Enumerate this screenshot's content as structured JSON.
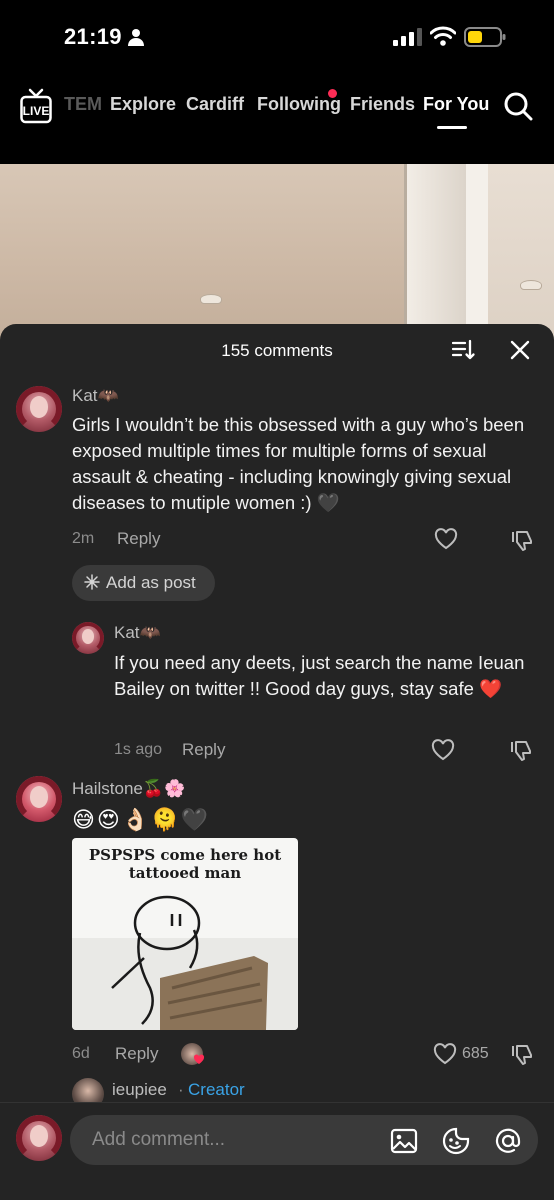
{
  "status_bar": {
    "time": "21:19"
  },
  "nav": {
    "items": [
      {
        "label": "TEM",
        "state": "faded"
      },
      {
        "label": "Explore",
        "state": "normal"
      },
      {
        "label": "Cardiff",
        "state": "normal"
      },
      {
        "label": "Following",
        "state": "normal",
        "badge": true
      },
      {
        "label": "Friends",
        "state": "normal"
      },
      {
        "label": "For You",
        "state": "active"
      }
    ],
    "live_label": "LIVE"
  },
  "sheet": {
    "title": "155 comments"
  },
  "comments": [
    {
      "username": "Kat🦇",
      "text": "Girls I wouldn’t be this obsessed with a guy who’s been exposed multiple times for multiple forms of sexual assault & cheating - including knowingly giving sexual diseases to mutiple women :) 🖤",
      "time": "2m",
      "reply_label": "Reply",
      "add_post_label": "Add as post"
    },
    {
      "username": "Kat🦇",
      "text": "If you need any deets, just search the name Ieuan Bailey on twitter !! Good day guys, stay safe ❤️",
      "time": "1s ago",
      "reply_label": "Reply"
    },
    {
      "username": "Hailstone🍒🌸",
      "emojis": "😅😍👌🏻🫠🖤",
      "meme_caption": "PSPSPS come here hot tattooed man",
      "time": "6d",
      "reply_label": "Reply",
      "likes": "685"
    },
    {
      "username": "ieupiee",
      "separator": "·",
      "role": "Creator"
    }
  ],
  "input": {
    "placeholder": "Add comment..."
  },
  "colors": {
    "accent_red": "#fe2c55",
    "creator_blue": "#3aa3e6",
    "sheet_bg": "#242424"
  }
}
